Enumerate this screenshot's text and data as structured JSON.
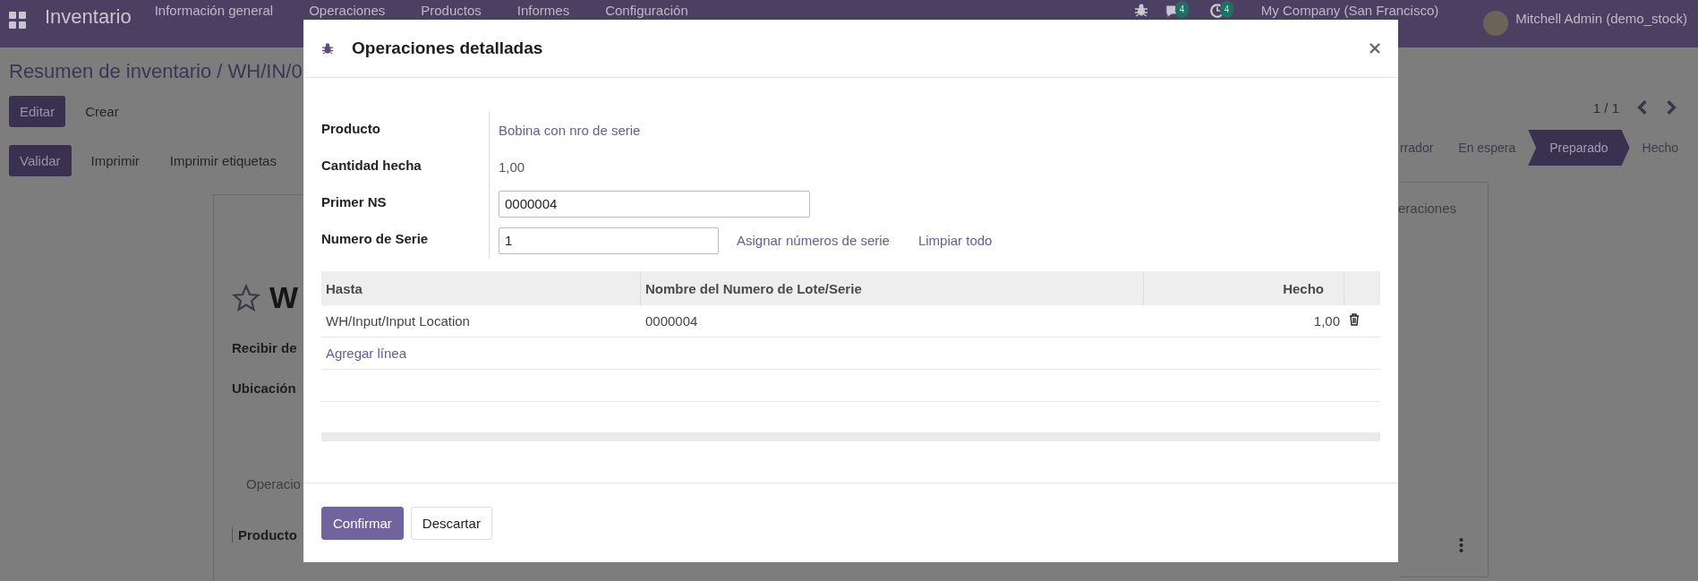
{
  "navbar": {
    "app_name": "Inventario",
    "menu": [
      {
        "label": "Información general"
      },
      {
        "label": "Operaciones"
      },
      {
        "label": "Productos"
      },
      {
        "label": "Informes"
      },
      {
        "label": "Configuración"
      }
    ],
    "badges": [
      {
        "kind": "chat",
        "count": "4"
      },
      {
        "kind": "activity",
        "count": "4"
      }
    ],
    "company": "My Company (San Francisco)",
    "user": "Mitchell Admin (demo_stock)"
  },
  "background": {
    "breadcrumb": "Resumen de inventario / WH/IN/0",
    "buttons": [
      {
        "label": "Editar",
        "kind": "primary"
      },
      {
        "label": "Crear",
        "kind": "plain"
      }
    ],
    "actions": [
      {
        "label": "Validar",
        "kind": "primary"
      },
      {
        "label": "Imprimir",
        "kind": "plain"
      },
      {
        "label": "Imprimir etiquetas",
        "kind": "plain"
      }
    ],
    "pager": "1 / 1",
    "statusbar": [
      {
        "label": "rrador",
        "selected": false
      },
      {
        "label": "En espera",
        "selected": false
      },
      {
        "label": "Preparado",
        "selected": true
      },
      {
        "label": "Hecho",
        "selected": false
      }
    ],
    "record_title": "W",
    "favorite": false,
    "fields": [
      "Recibir de",
      "Ubicación"
    ],
    "tab_left": "Operacio",
    "tab_right": "eraciones",
    "column": "Producto"
  },
  "dialog": {
    "title": "Operaciones detalladas",
    "fields": [
      {
        "label": "Producto",
        "kind": "link",
        "value": "Bobina con nro de serie"
      },
      {
        "label": "Cantidad hecha",
        "kind": "text",
        "value": "1,00"
      },
      {
        "label": "Primer NS",
        "kind": "input",
        "value": "0000004"
      },
      {
        "label": "Numero de Serie",
        "kind": "input_actions",
        "value": "1",
        "actions": [
          "Asignar números de serie",
          "Limpiar todo"
        ]
      }
    ],
    "table": {
      "columns": [
        "Hasta",
        "Nombre del Numero de Lote/Serie",
        "Hecho"
      ],
      "rows": [
        {
          "cells": [
            "WH/Input/Input Location",
            "0000004",
            "1,00"
          ]
        }
      ],
      "add_line": "Agregar línea"
    },
    "buttons": [
      {
        "label": "Confirmar",
        "kind": "primary"
      },
      {
        "label": "Descartar",
        "kind": "secondary"
      }
    ]
  }
}
